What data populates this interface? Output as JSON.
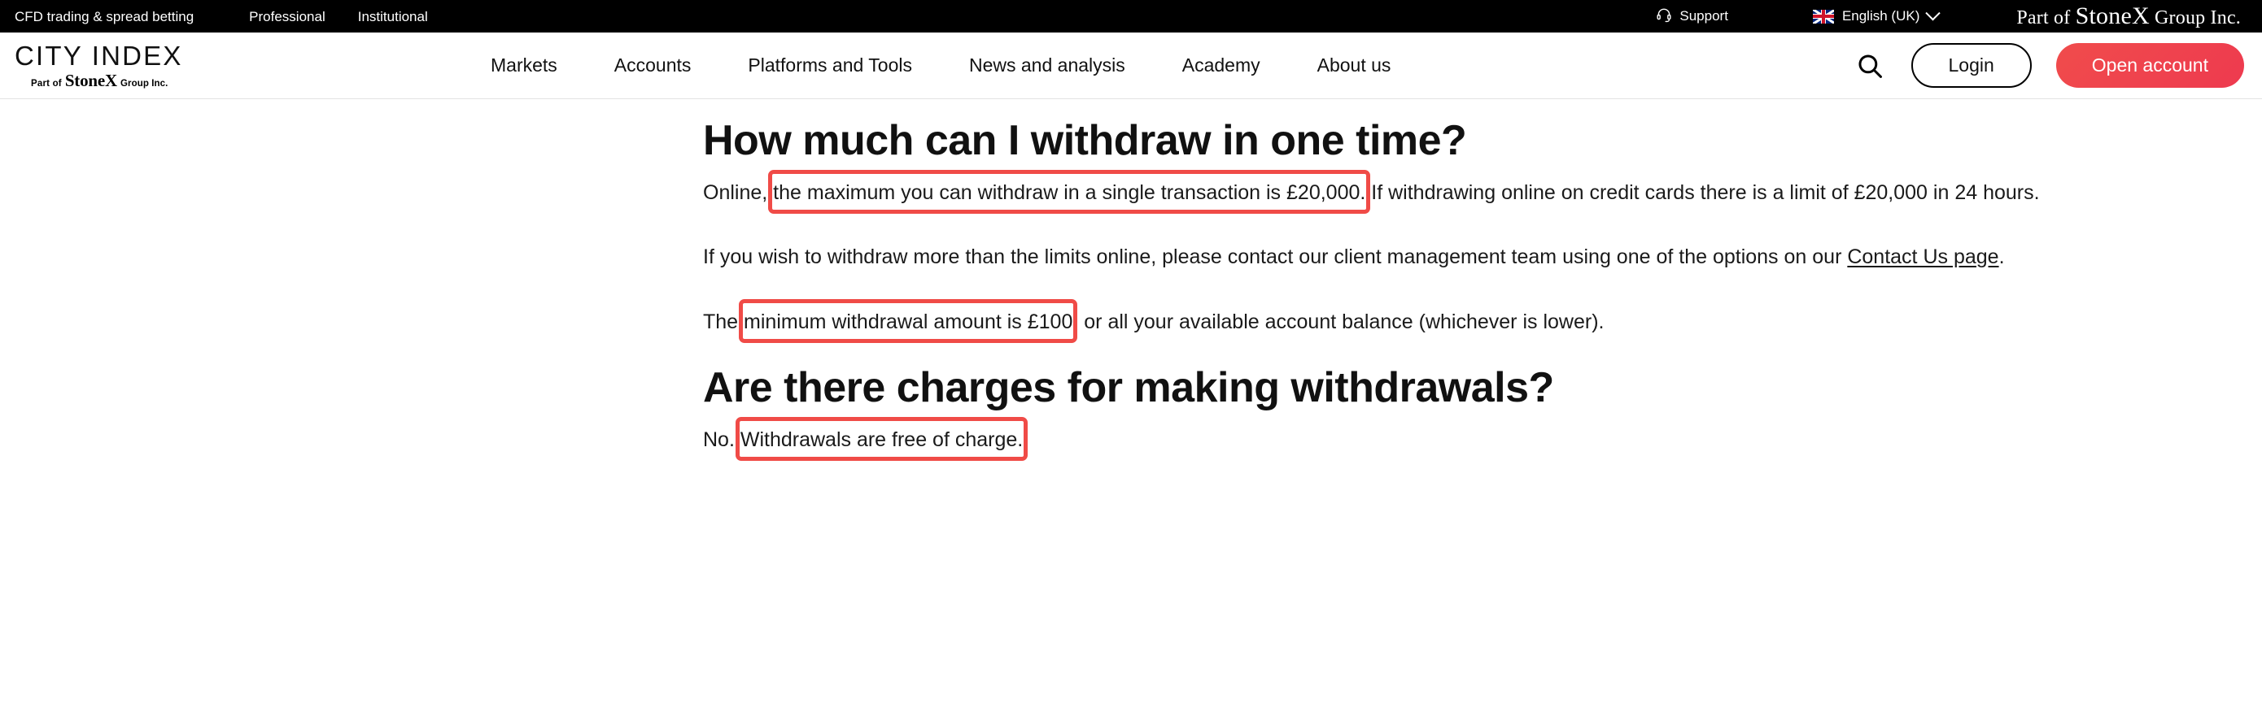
{
  "topbar": {
    "links": [
      {
        "label": "CFD trading & spread betting"
      },
      {
        "label": "Professional"
      },
      {
        "label": "Institutional"
      }
    ],
    "support_label": "Support",
    "support_icon": "headset-icon",
    "language_label": "English (UK)",
    "language_flag_icon": "uk-flag-icon",
    "language_chevron_icon": "chevron-down-icon",
    "parent_company": {
      "prefix": "Part of ",
      "brand": "StoneX",
      "suffix": " Group Inc."
    }
  },
  "header": {
    "logo": {
      "title": "CITY INDEX",
      "sub_prefix": "Part of",
      "sub_brand": "StoneX",
      "sub_suffix": "Group Inc."
    },
    "nav": [
      {
        "label": "Markets"
      },
      {
        "label": "Accounts"
      },
      {
        "label": "Platforms and Tools"
      },
      {
        "label": "News and analysis"
      },
      {
        "label": "Academy"
      },
      {
        "label": "About us"
      }
    ],
    "search_icon": "search-icon",
    "login_label": "Login",
    "open_account_label": "Open account"
  },
  "content": {
    "heading_1": "How much can I withdraw in one time?",
    "para_1_pre": "Online, ",
    "para_1_highlight": "the maximum you can withdraw in a single transaction is £20,000.",
    "para_1_post": " If withdrawing online on credit cards there is a limit of £20,000 in 24 hours.",
    "para_2_pre": "If you wish to withdraw more than the limits online, please contact our client management team using one of the options on our ",
    "para_2_link": "Contact Us page",
    "para_2_post": ".",
    "para_3_pre": "The ",
    "para_3_highlight": "minimum withdrawal amount is £100",
    "para_3_post": ", or all your available account balance (whichever is lower).",
    "heading_2": "Are there charges for making withdrawals?",
    "para_4_pre": "No. ",
    "para_4_highlight": "Withdrawals are free of charge."
  },
  "colors": {
    "annotation_red": "#f04b47",
    "cta_red": "#ee3a4f",
    "topbar_bg": "#000000"
  }
}
